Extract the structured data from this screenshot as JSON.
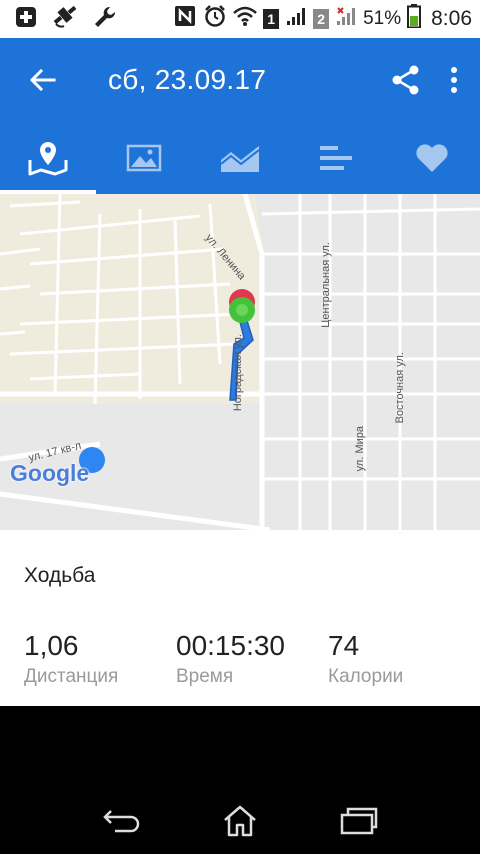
{
  "status_bar": {
    "battery_percent": "51%",
    "time": "8:06",
    "sim1_label": "1",
    "sim2_label": "2",
    "icons": [
      "add-icon",
      "satellite-icon",
      "wrench-icon",
      "nfc-icon",
      "alarm-icon",
      "wifi-icon",
      "signal-icon",
      "battery-icon"
    ]
  },
  "app_bar": {
    "title": "сб, 23.09.17",
    "back_icon": "arrow-back-icon",
    "share_icon": "share-icon",
    "menu_icon": "more-vert-icon"
  },
  "tabs": [
    {
      "icon": "map-icon",
      "active": true
    },
    {
      "icon": "photo-icon",
      "active": false
    },
    {
      "icon": "chart-area-icon",
      "active": false
    },
    {
      "icon": "bars-icon",
      "active": false
    },
    {
      "icon": "heart-icon",
      "active": false
    }
  ],
  "map": {
    "street_lenina": "ул. Ленина",
    "street_centralnaya": "Центральная ул.",
    "street_nogradskaya": "Ноградская ул.",
    "street_vostochnaya": "Восточная ул.",
    "street_mira": "ул. Мира",
    "street_17kv": "ул. 17 кв-л",
    "logo": "Google",
    "colors": {
      "route": "#2e7be0",
      "start": "#e0394f",
      "end": "#44c23a",
      "location": "#2e86f0"
    }
  },
  "activity": {
    "name": "Ходьба",
    "stats": [
      {
        "value": "1,06",
        "label": "Дистанция"
      },
      {
        "value": "00:15:30",
        "label": "Время"
      },
      {
        "value": "74",
        "label": "Калории"
      }
    ]
  },
  "nav_bar": {
    "icons": [
      "back-nav-icon",
      "home-nav-icon",
      "recents-nav-icon"
    ]
  }
}
